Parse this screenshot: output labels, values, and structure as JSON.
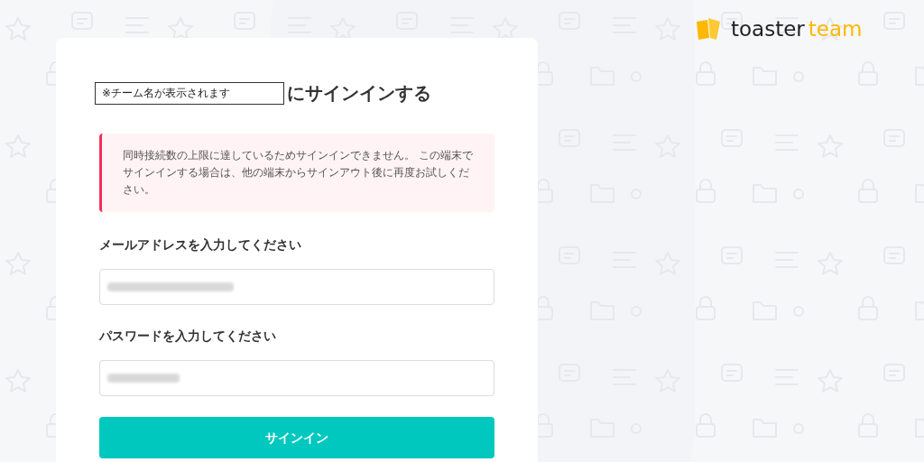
{
  "logo": {
    "word_1": "toaster",
    "word_2": "team"
  },
  "sign_in_card": {
    "team_name_placeholder": "※チーム名が表示されます",
    "heading": "にサインインする",
    "alert": {
      "message": "同時接続数の上限に達しているためサインインできません。 この端末でサインインする場合は、他の端末からサインアウト後に再度お試しください。"
    },
    "fields": [
      {
        "label": "メールアドレスを入力してください",
        "kind": "email"
      },
      {
        "label": "パスワードを入力してください",
        "kind": "password"
      }
    ],
    "button": "サインイン"
  }
}
